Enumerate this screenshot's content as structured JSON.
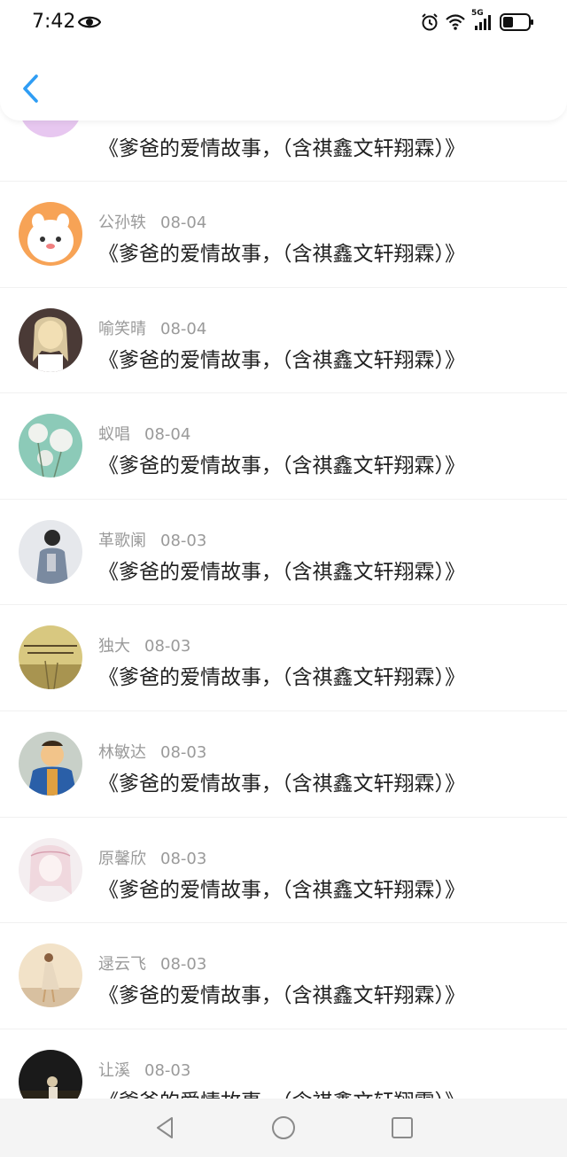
{
  "status_bar": {
    "time": "7:42",
    "network": "5G"
  },
  "header": {
    "back_icon": "chevron-left-icon",
    "accent_color": "#2f9df4"
  },
  "comments": [
    {
      "name": "",
      "date": "",
      "text": "《爹爸的爱情故事，（含祺鑫文轩翔霖）》",
      "avatar_colors": [
        "#f6d6ea",
        "#e7c7f0"
      ]
    },
    {
      "name": "公孙轶",
      "date": "08-04",
      "text": "《爹爸的爱情故事，（含祺鑫文轩翔霖）》",
      "avatar_colors": [
        "#f7a356",
        "#ffffff"
      ]
    },
    {
      "name": "喻笑晴",
      "date": "08-04",
      "text": "《爹爸的爱情故事，（含祺鑫文轩翔霖）》",
      "avatar_colors": [
        "#4a3a36",
        "#f0d8c8"
      ]
    },
    {
      "name": "蚁唱",
      "date": "08-04",
      "text": "《爹爸的爱情故事，（含祺鑫文轩翔霖）》",
      "avatar_colors": [
        "#8ccab8",
        "#f0f2ee"
      ]
    },
    {
      "name": "革歌阑",
      "date": "08-03",
      "text": "《爹爸的爱情故事，（含祺鑫文轩翔霖）》",
      "avatar_colors": [
        "#d9dce2",
        "#7a8aa0"
      ]
    },
    {
      "name": "独大",
      "date": "08-03",
      "text": "《爹爸的爱情故事，（含祺鑫文轩翔霖）》",
      "avatar_colors": [
        "#d8c880",
        "#a89450"
      ]
    },
    {
      "name": "林敏达",
      "date": "08-03",
      "text": "《爹爸的爱情故事，（含祺鑫文轩翔霖）》",
      "avatar_colors": [
        "#2a5fa8",
        "#f2c48a"
      ]
    },
    {
      "name": "原馨欣",
      "date": "08-03",
      "text": "《爹爸的爱情故事，（含祺鑫文轩翔霖）》",
      "avatar_colors": [
        "#f4eef0",
        "#e8b8c4"
      ]
    },
    {
      "name": "逯云飞",
      "date": "08-03",
      "text": "《爹爸的爱情故事，（含祺鑫文轩翔霖）》",
      "avatar_colors": [
        "#f2e2c8",
        "#c8a070"
      ]
    },
    {
      "name": "让溪",
      "date": "08-03",
      "text": "《爹爸的爱情故事，（含祺鑫文轩翔霖）》",
      "avatar_colors": [
        "#1a1a1a",
        "#4a4030"
      ]
    }
  ],
  "nav_bar": {
    "back": "triangle-back-icon",
    "home": "circle-home-icon",
    "recents": "square-recents-icon"
  }
}
